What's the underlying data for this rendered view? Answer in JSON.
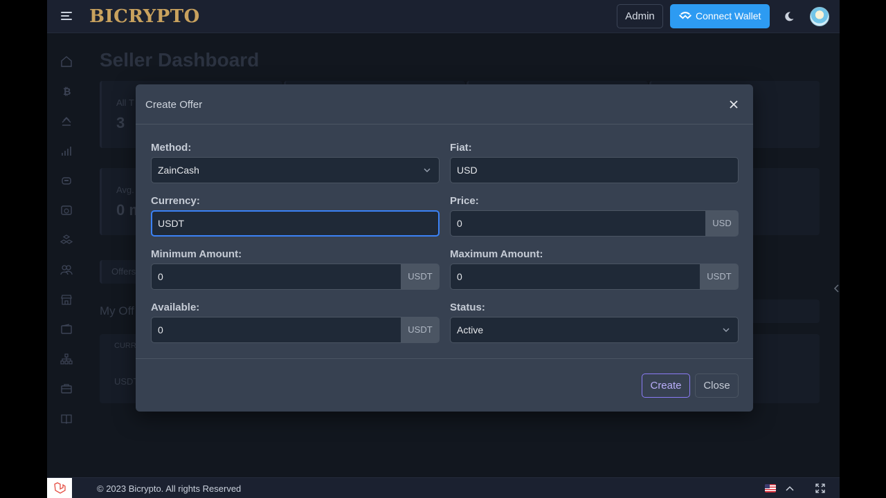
{
  "header": {
    "logo": "BICRYPTO",
    "admin_label": "Admin",
    "connect_wallet_label": "Connect Wallet"
  },
  "page": {
    "title": "Seller Dashboard",
    "cards": [
      {
        "label": "All T",
        "value": "3"
      },
      {
        "label": "Avg.",
        "value": "0 m"
      }
    ],
    "tab_label": "Offers",
    "section_title": "My Off",
    "table_header": "CURR",
    "table_cell": "USDT"
  },
  "modal": {
    "title": "Create Offer",
    "fields": {
      "method": {
        "label": "Method:",
        "value": "ZainCash"
      },
      "fiat": {
        "label": "Fiat:",
        "value": "USD"
      },
      "currency": {
        "label": "Currency:",
        "value": "USDT"
      },
      "price": {
        "label": "Price:",
        "value": "0",
        "addon": "USD"
      },
      "min_amount": {
        "label": "Minimum Amount:",
        "value": "0",
        "addon": "USDT"
      },
      "max_amount": {
        "label": "Maximum Amount:",
        "value": "0",
        "addon": "USDT"
      },
      "available": {
        "label": "Available:",
        "value": "0",
        "addon": "USDT"
      },
      "status": {
        "label": "Status:",
        "value": "Active"
      }
    },
    "create_label": "Create",
    "close_label": "Close"
  },
  "footer": {
    "copyright": "© 2023 Bicrypto. All rights Reserved"
  },
  "colors": {
    "accent": "#2d9bf2",
    "brand": "#c9a25e",
    "create_button": "#8b7cf6",
    "focus_ring": "#3b82f6"
  }
}
